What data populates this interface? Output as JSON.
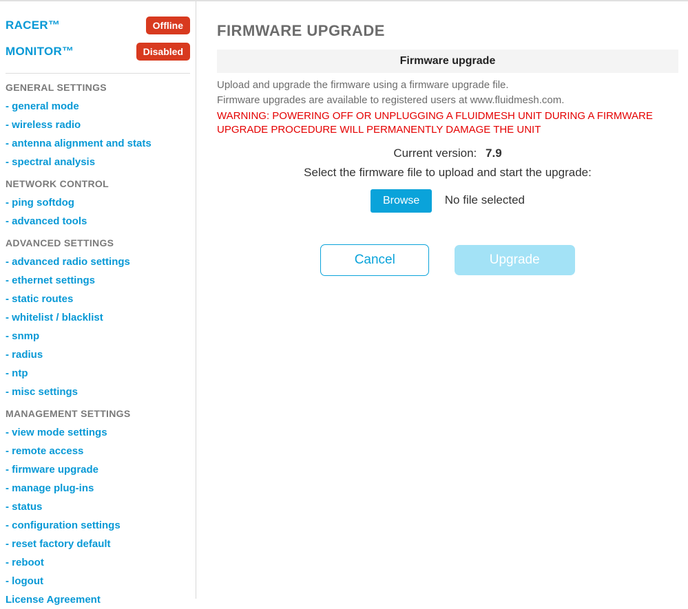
{
  "status": {
    "racer": {
      "label": "RACER™",
      "badge": "Offline"
    },
    "monitor": {
      "label": "MONITOR™",
      "badge": "Disabled"
    }
  },
  "sidebar": {
    "sections": [
      {
        "title": "GENERAL SETTINGS",
        "items": [
          "- general mode",
          "- wireless radio",
          "- antenna alignment and stats",
          "- spectral analysis"
        ]
      },
      {
        "title": "NETWORK CONTROL",
        "items": [
          "- ping softdog",
          "- advanced tools"
        ]
      },
      {
        "title": "ADVANCED SETTINGS",
        "items": [
          "- advanced radio settings",
          "- ethernet settings",
          "- static routes",
          "- whitelist / blacklist",
          "- snmp",
          "- radius",
          "- ntp",
          "- misc settings"
        ]
      },
      {
        "title": "MANAGEMENT SETTINGS",
        "items": [
          "- view mode settings",
          "- remote access",
          "- firmware upgrade",
          "- manage plug-ins",
          "- status",
          "- configuration settings",
          "- reset factory default",
          "- reboot",
          "- logout",
          "License Agreement"
        ]
      }
    ]
  },
  "main": {
    "title": "FIRMWARE UPGRADE",
    "panel_title": "Firmware upgrade",
    "desc1": "Upload and upgrade the firmware using a firmware upgrade file.",
    "desc2": "Firmware upgrades are available to registered users at www.fluidmesh.com.",
    "warning": "WARNING: POWERING OFF OR UNPLUGGING A FLUIDMESH UNIT DURING A FIRMWARE UPGRADE PROCEDURE WILL PERMANENTLY DAMAGE THE UNIT",
    "version_label": "Current version:",
    "version_value": "7.9",
    "select_text": "Select the firmware file to upload and start the upgrade:",
    "browse_label": "Browse",
    "file_status": "No file selected",
    "cancel_label": "Cancel",
    "upgrade_label": "Upgrade"
  }
}
